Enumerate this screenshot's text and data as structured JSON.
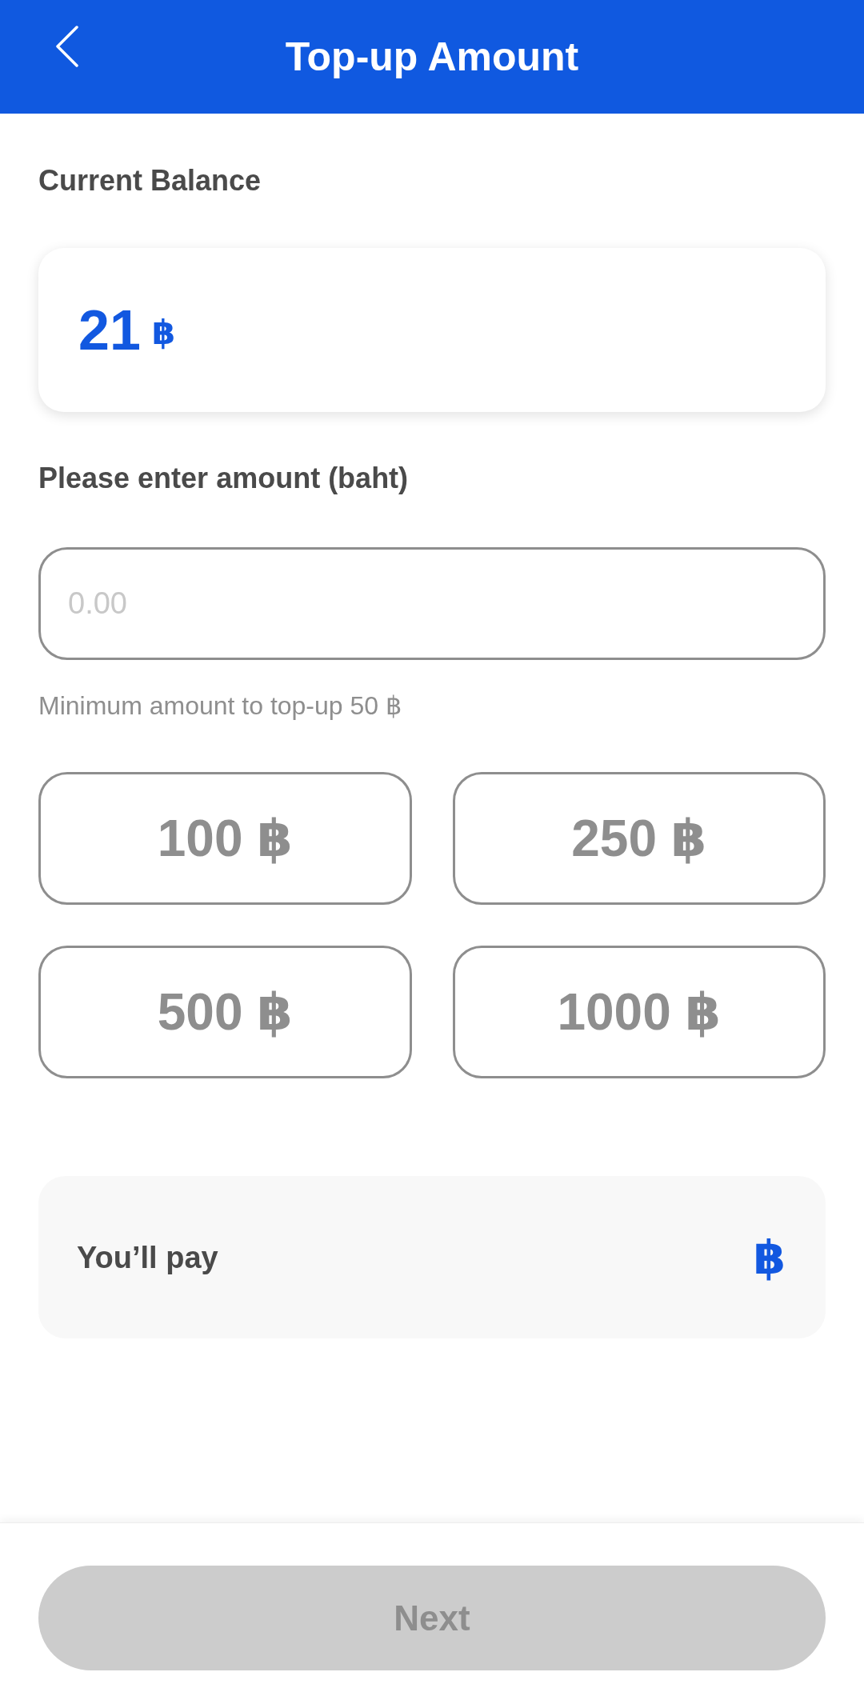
{
  "header": {
    "title": "Top-up Amount"
  },
  "balance": {
    "label": "Current Balance",
    "amount": "21",
    "currency": "฿"
  },
  "amount_input": {
    "label": "Please enter amount (baht)",
    "placeholder": "0.00",
    "hint": "Minimum amount to top-up 50 ฿"
  },
  "presets": [
    {
      "label": "100 ฿"
    },
    {
      "label": "250 ฿"
    },
    {
      "label": "500 ฿"
    },
    {
      "label": "1000 ฿"
    }
  ],
  "summary": {
    "label": "You’ll pay",
    "currency": "฿"
  },
  "next_button": {
    "label": "Next",
    "disabled": true
  }
}
